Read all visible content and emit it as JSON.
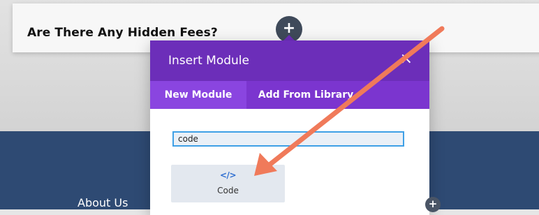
{
  "faq": {
    "title": "Are There Any Hidden Fees?"
  },
  "add_button": {
    "symbol": "+"
  },
  "modal": {
    "title": "Insert Module",
    "close_symbol": "×",
    "tabs": [
      {
        "label": "New Module",
        "active": true
      },
      {
        "label": "Add From Library",
        "active": false
      }
    ],
    "search": {
      "value": "code"
    },
    "modules": [
      {
        "label": "Code",
        "icon": "</>",
        "icon_name": "code-icon"
      }
    ],
    "accent_color": "#6c2eb9"
  },
  "footer": {
    "link": "About Us",
    "add_symbol": "+"
  },
  "annotation": {
    "arrow_color": "#f07a5a"
  }
}
